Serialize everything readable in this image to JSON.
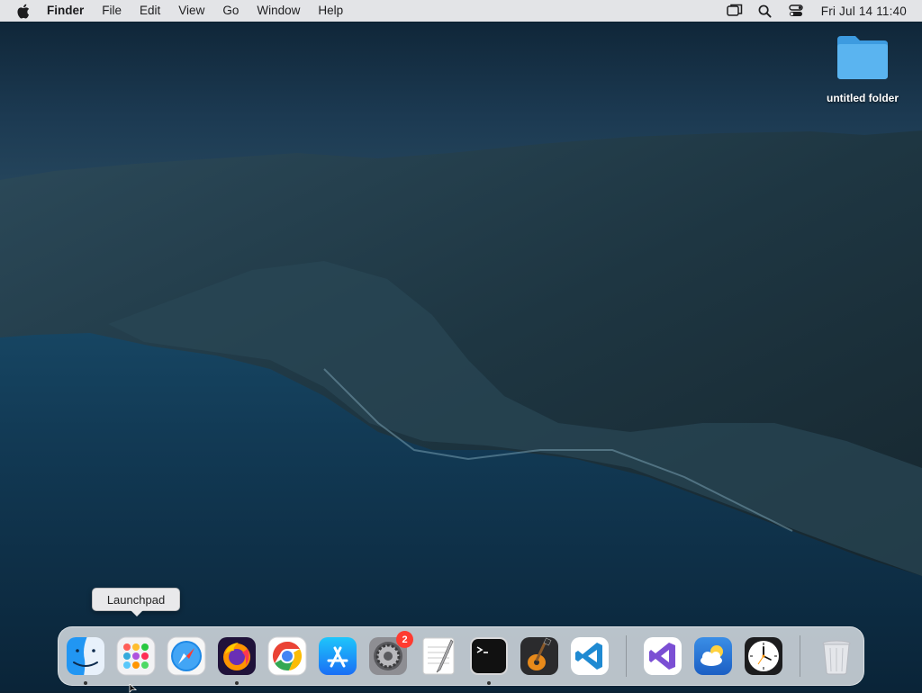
{
  "menubar": {
    "app_name": "Finder",
    "menus": [
      "File",
      "Edit",
      "View",
      "Go",
      "Window",
      "Help"
    ],
    "clock": "Fri Jul 14  11:40",
    "status_icons": [
      "screen-mirroring-icon",
      "spotlight-search-icon",
      "control-center-icon"
    ]
  },
  "desktop": {
    "folder_label": "untitled folder"
  },
  "tooltip": {
    "text": "Launchpad"
  },
  "dock": {
    "apps": [
      {
        "name": "Finder",
        "icon": "finder-icon",
        "running": true
      },
      {
        "name": "Launchpad",
        "icon": "launchpad-icon",
        "running": false
      },
      {
        "name": "Safari",
        "icon": "safari-icon",
        "running": false
      },
      {
        "name": "Firefox",
        "icon": "firefox-icon",
        "running": true
      },
      {
        "name": "Google Chrome",
        "icon": "chrome-icon",
        "running": false
      },
      {
        "name": "App Store",
        "icon": "app-store-icon",
        "running": false
      },
      {
        "name": "System Preferences",
        "icon": "system-preferences-icon",
        "running": false,
        "badge": "2"
      },
      {
        "name": "TextEdit",
        "icon": "textedit-icon",
        "running": false
      },
      {
        "name": "Terminal",
        "icon": "terminal-icon",
        "running": true
      },
      {
        "name": "GarageBand",
        "icon": "garageband-icon",
        "running": false
      },
      {
        "name": "Visual Studio Code",
        "icon": "vscode-icon",
        "running": false
      },
      {
        "name": "Visual Studio",
        "icon": "visual-studio-icon",
        "running": false
      },
      {
        "name": "Weather",
        "icon": "weather-icon",
        "running": false
      },
      {
        "name": "Clock",
        "icon": "clock-icon",
        "running": false
      },
      {
        "name": "Trash",
        "icon": "trash-icon",
        "running": false
      }
    ]
  },
  "colors": {
    "menubar_bg": "#ececee",
    "badge": "#ff3b30",
    "folder": "#5ab4f0"
  }
}
